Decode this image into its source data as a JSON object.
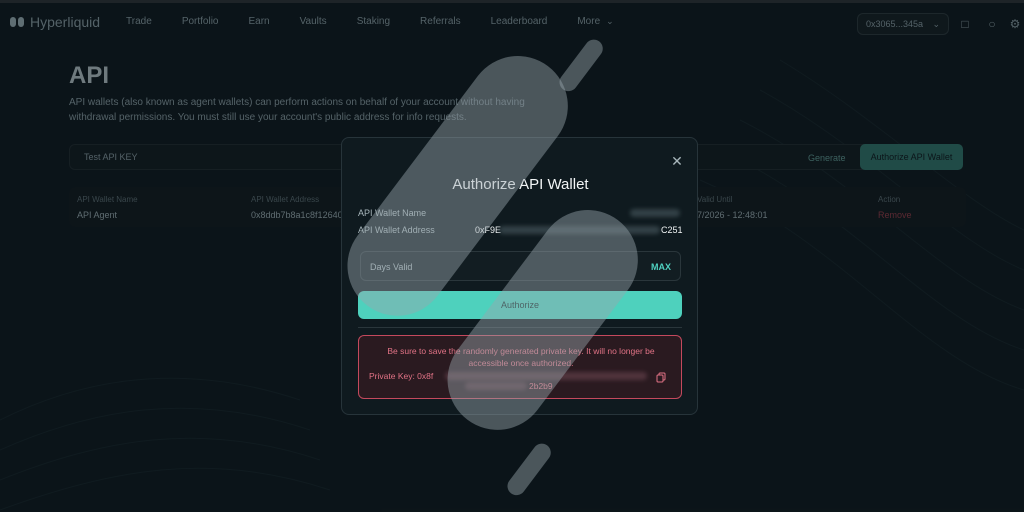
{
  "brand": {
    "name": "Hyperliquid"
  },
  "nav": {
    "items": [
      "Trade",
      "Portfolio",
      "Earn",
      "Vaults",
      "Staking",
      "Referrals",
      "Leaderboard"
    ],
    "more_label": "More"
  },
  "account": {
    "address": "0x3065...345a"
  },
  "page": {
    "title": "API",
    "description": "API wallets (also known as agent wallets) can perform actions on behalf of your account without having withdrawal permissions. You must still use your account's public address for info requests."
  },
  "key_input": {
    "value": "Test API KEY"
  },
  "generate_label": "Generate",
  "authorize_wallet_label": "Authorize API Wallet",
  "table": {
    "headers": [
      "API Wallet Name",
      "API Wallet Address",
      "Valid Until",
      "Action"
    ],
    "rows": [
      {
        "name": "API Agent",
        "address": "0x8ddb7b8a1c8f12640",
        "valid_until": "7/2026 - 12:48:01",
        "action": "Remove"
      }
    ]
  },
  "modal": {
    "title": "Authorize API Wallet",
    "wallet_name_label": "API Wallet Name",
    "wallet_address_label": "API Wallet Address",
    "address_start": "0xF9E",
    "address_end": "C251",
    "days_label": "Days Valid",
    "max_label": "MAX",
    "authorize_label": "Authorize",
    "warning_text": "Be sure to save the randomly generated private key. It will no longer be accessible once authorized.",
    "private_key_label": "Private Key: 0x8f",
    "private_key_end": "2b2b9"
  },
  "colors": {
    "accent": "#4ed1bd",
    "danger": "#e27386",
    "background": "#0f1a1f"
  },
  "icons": [
    "chevron-down-icon",
    "chat-icon",
    "globe-icon",
    "settings-icon",
    "close-icon",
    "copy-icon"
  ]
}
